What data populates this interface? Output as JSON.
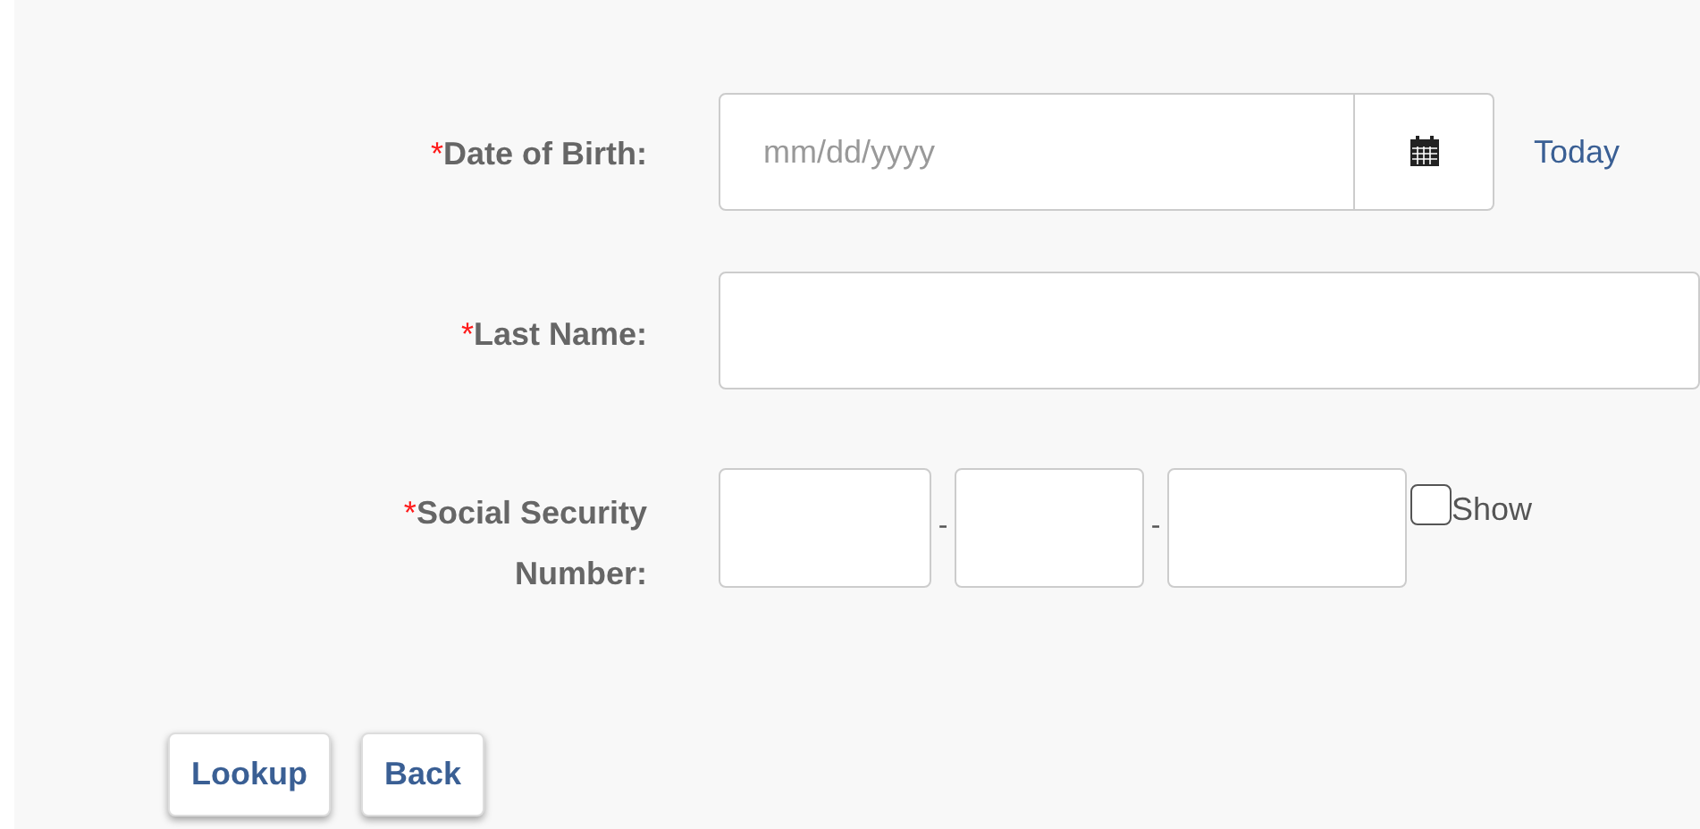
{
  "fields": [
    {
      "kind": "date",
      "required_mark": "*",
      "label": "Date of Birth:",
      "placeholder": "mm/dd/yyyy",
      "link": "Today"
    },
    {
      "kind": "text",
      "required_mark": "*",
      "label": "Last Name:"
    },
    {
      "kind": "ssn",
      "required_mark": "*",
      "label": "Social Security Number:",
      "separators": [
        "-",
        "-"
      ],
      "show": {
        "label": "Show",
        "checked": false
      }
    }
  ],
  "buttons": [
    "Lookup",
    "Back"
  ]
}
